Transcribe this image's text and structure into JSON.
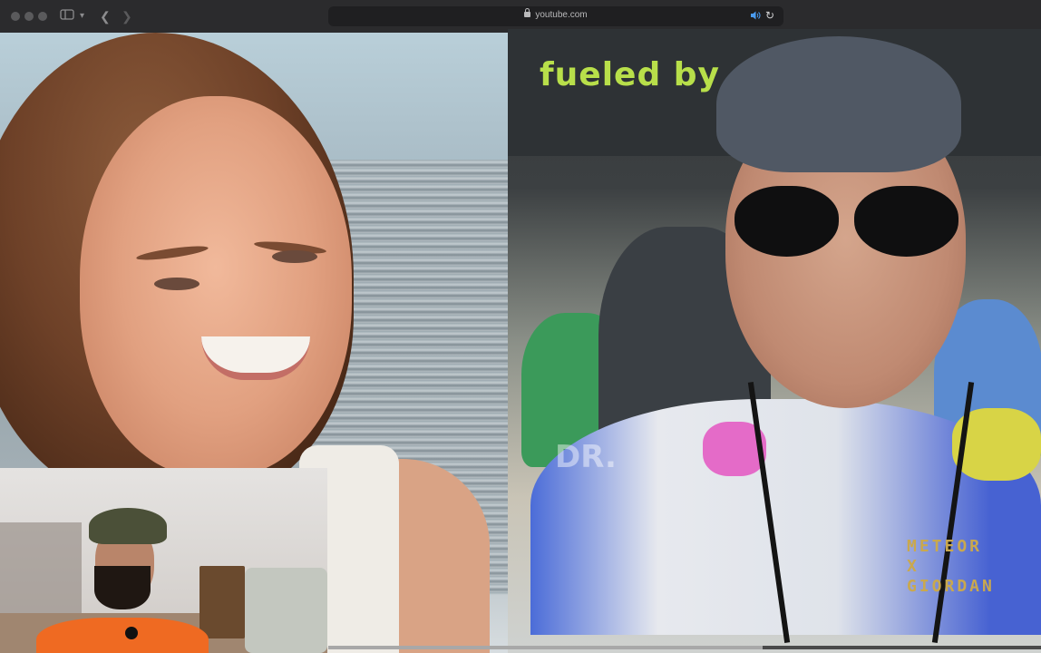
{
  "browser": {
    "url": "youtube.com",
    "icons": [
      "traffic-light-icons",
      "sidebar-icon",
      "chevron-down-icon",
      "back-icon",
      "forward-icon",
      "lock-icon",
      "speaker-icon",
      "reload-icon"
    ]
  },
  "video": {
    "tent_text": "fueled by",
    "watermark": "DR.",
    "jersey_text": "METEOR\nX\nGIORDAN",
    "playback_progress": 0.61
  }
}
